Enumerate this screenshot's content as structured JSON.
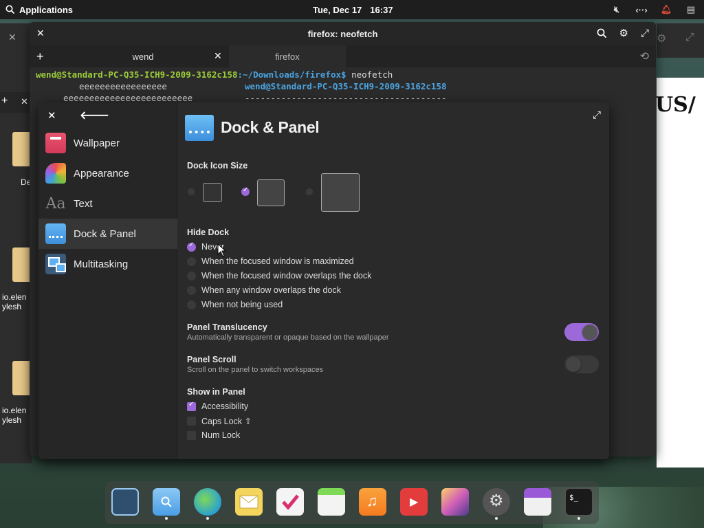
{
  "top_panel": {
    "applications_label": "Applications",
    "date": "Tue, Dec 17",
    "time": "16:37"
  },
  "terminal": {
    "title": "firefox: neofetch",
    "tabs": [
      {
        "label": "wend"
      },
      {
        "label": "firefox"
      }
    ],
    "prompt_user": "wend@Standard-PC-Q35-ICH9-2009-3162c158",
    "prompt_path": ":~/Downloads/firefox$",
    "command": " neofetch",
    "ascii_line1": "eeeeeeeeeeeeeeeee",
    "ascii_line2": "eeeeeeeeeeeeeeeeeeeeeeeee",
    "neofetch_user": "wend@Standard-PC-Q35-ICH9-2009-3162c158",
    "neofetch_sep": "---------------------------------------"
  },
  "desktop": {
    "labels": [
      "De",
      "io.elen",
      "ylesh",
      "io.elen",
      "ylesh"
    ],
    "white_page_text": "US/"
  },
  "settings": {
    "sidebar": [
      {
        "label": "Wallpaper",
        "icon": "wallpaper-icon"
      },
      {
        "label": "Appearance",
        "icon": "appearance-icon"
      },
      {
        "label": "Text",
        "icon": "text-icon",
        "glyph": "Aa"
      },
      {
        "label": "Dock & Panel",
        "icon": "dock-icon"
      },
      {
        "label": "Multitasking",
        "icon": "multitasking-icon"
      }
    ],
    "page_title": "Dock & Panel",
    "dock_icon_size": {
      "heading": "Dock Icon Size",
      "options": [
        "small",
        "medium",
        "large"
      ],
      "selected": "medium"
    },
    "hide_dock": {
      "heading": "Hide Dock",
      "options": [
        "Never",
        "When the focused window is maximized",
        "When the focused window overlaps the dock",
        "When any window overlaps the dock",
        "When not being used"
      ],
      "selected": "Never"
    },
    "panel_translucency": {
      "title": "Panel Translucency",
      "description": "Automatically transparent or opaque based on the wallpaper",
      "enabled": true
    },
    "panel_scroll": {
      "title": "Panel Scroll",
      "description": "Scroll on the panel to switch workspaces",
      "enabled": false
    },
    "show_in_panel": {
      "heading": "Show in Panel",
      "items": [
        {
          "label": "Accessibility",
          "checked": true
        },
        {
          "label": "Caps Lock ⇧",
          "checked": false
        },
        {
          "label": "Num Lock",
          "checked": false
        }
      ]
    }
  },
  "dock": {
    "items": [
      {
        "name": "multitasking-view",
        "running": false
      },
      {
        "name": "files",
        "running": true
      },
      {
        "name": "web-browser",
        "running": true
      },
      {
        "name": "mail",
        "running": false
      },
      {
        "name": "tasks",
        "running": false
      },
      {
        "name": "calendar",
        "running": false
      },
      {
        "name": "music",
        "running": false
      },
      {
        "name": "videos",
        "running": false
      },
      {
        "name": "photos",
        "running": false
      },
      {
        "name": "system-settings",
        "running": true
      },
      {
        "name": "app-store",
        "running": false
      },
      {
        "name": "terminal",
        "running": true
      }
    ],
    "terminal_glyph": "$_"
  },
  "colors": {
    "accent": "#9b6ad8",
    "prompt_user": "#9ccc3a",
    "prompt_path": "#4aa3e0"
  }
}
